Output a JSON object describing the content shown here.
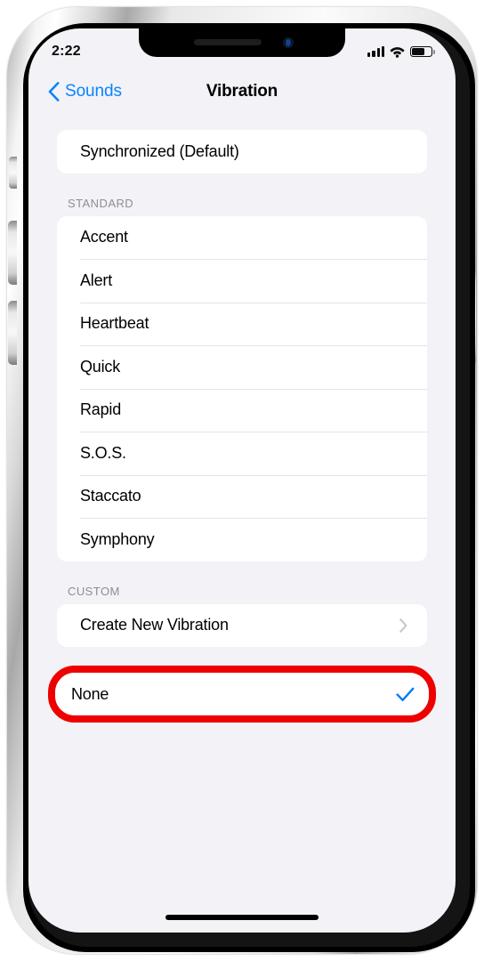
{
  "device": {
    "type": "iphone",
    "frame_color": "#c9c9c9",
    "bezel_color": "#000000"
  },
  "status_bar": {
    "time": "2:22",
    "cellular_icon": "cellular-bars-icon",
    "cellular_bars": 4,
    "wifi_icon": "wifi-icon",
    "battery_icon": "battery-icon",
    "battery_percent": 62
  },
  "nav_bar": {
    "back_icon": "chevron-left-icon",
    "back_label": "Sounds",
    "title": "Vibration"
  },
  "theme": {
    "background": "#f2f2f7",
    "card": "#ffffff",
    "accent_blue": "#0a84ff",
    "checkmark_blue": "#007aff",
    "separator": "#e4e4e6",
    "section_header_text": "#8e8e93",
    "highlight_red": "#ee0000",
    "chevron_gray": "#c4c4c6"
  },
  "sections": [
    {
      "id": "default",
      "header": "",
      "rows": [
        {
          "label": "Synchronized (Default)",
          "accessory": "none"
        }
      ]
    },
    {
      "id": "standard",
      "header": "STANDARD",
      "rows": [
        {
          "label": "Accent",
          "accessory": "none"
        },
        {
          "label": "Alert",
          "accessory": "none"
        },
        {
          "label": "Heartbeat",
          "accessory": "none"
        },
        {
          "label": "Quick",
          "accessory": "none"
        },
        {
          "label": "Rapid",
          "accessory": "none"
        },
        {
          "label": "S.O.S.",
          "accessory": "none"
        },
        {
          "label": "Staccato",
          "accessory": "none"
        },
        {
          "label": "Symphony",
          "accessory": "none"
        }
      ]
    },
    {
      "id": "custom",
      "header": "CUSTOM",
      "rows": [
        {
          "label": "Create New Vibration",
          "accessory": "chevron-right-icon"
        }
      ]
    }
  ],
  "highlighted_row": {
    "label": "None",
    "accessory": "checkmark-icon",
    "selected": true,
    "annotation_color": "#ee0000"
  },
  "home_indicator": "home-indicator"
}
